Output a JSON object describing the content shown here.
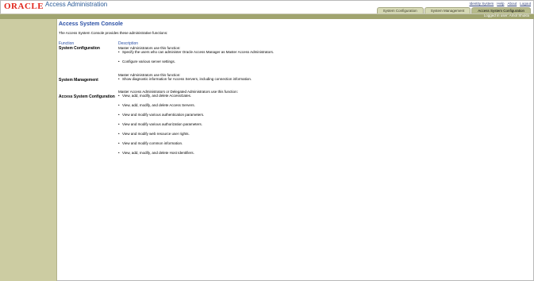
{
  "header": {
    "logo_text": "ORACLE",
    "app_title": "Access Administration",
    "links": [
      "Identity System",
      "Help",
      "About",
      "Logout"
    ],
    "tabs": [
      {
        "label": "System Configuration",
        "active": false
      },
      {
        "label": "System Management",
        "active": false
      },
      {
        "label": "Access System Configuration",
        "active": true
      }
    ],
    "logged_in": "Logged in user: Amol Shukla"
  },
  "colors": {
    "oracle_red": "#e1251b",
    "title_blue": "#2a4fa5",
    "sidebar": "#cccca2",
    "user_bar": "#a0a46f"
  },
  "main": {
    "title": "Access System Console",
    "intro": "The Access System Console provides these administrative functions:",
    "col_function": "Function",
    "col_description": "Description",
    "rows": [
      {
        "function": "System Configuration",
        "who": "Master Administrators use this function:",
        "items": [
          "Specify the users who can administer Oracle Access Manager as Master Access Administrators.",
          "Configure various server settings."
        ]
      },
      {
        "function": "System Management",
        "who": "Master Administrators use this function:",
        "items": [
          "Show diagnostic information for Access Servers, including connection information."
        ]
      },
      {
        "function": "Access System Configuration",
        "who": "Master Access Administrators or Delegated Administrators use this function:",
        "items": [
          "View, add, modify, and delete AccessGates.",
          "View, add, modify, and delete Access Servers.",
          "View and modify various authentication parameters.",
          "View and modify various authorization parameters.",
          "View and modify web resource user rights.",
          "View and modify common information.",
          "View, add, modify, and delete Host Identifiers."
        ]
      }
    ]
  }
}
